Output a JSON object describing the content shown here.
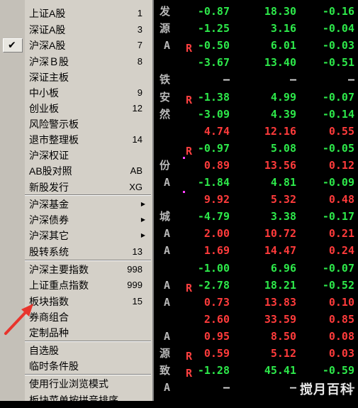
{
  "menu": {
    "items": [
      {
        "label": "上证A股",
        "shortcut": "1"
      },
      {
        "label": "深证A股",
        "shortcut": "3"
      },
      {
        "label": "沪深A股",
        "shortcut": "7",
        "checked": true
      },
      {
        "label": "沪深Ｂ股",
        "shortcut": "8"
      },
      {
        "label": "深证主板",
        "shortcut": ""
      },
      {
        "label": "中小板",
        "shortcut": "9"
      },
      {
        "label": "创业板",
        "shortcut": "12"
      },
      {
        "label": "风险警示板",
        "shortcut": ""
      },
      {
        "label": "退市整理板",
        "shortcut": "14"
      },
      {
        "label": "沪深权证",
        "shortcut": ""
      },
      {
        "label": "AB股对照",
        "shortcut": "AB"
      },
      {
        "label": "新股发行",
        "shortcut": "XG"
      },
      {
        "label": "沪深基金",
        "submenu": true
      },
      {
        "label": "沪深债券",
        "submenu": true
      },
      {
        "label": "沪深其它",
        "submenu": true
      },
      {
        "label": "股转系统",
        "shortcut": "13"
      },
      {
        "label": "沪深主要指数",
        "shortcut": "998"
      },
      {
        "label": "上证重点指数",
        "shortcut": "999"
      },
      {
        "label": "板块指数",
        "shortcut": "15"
      },
      {
        "label": "券商组合",
        "shortcut": ""
      },
      {
        "label": "定制品种",
        "shortcut": ""
      },
      {
        "label": "自选股",
        "shortcut": ""
      },
      {
        "label": "临时条件股",
        "shortcut": ""
      },
      {
        "label": "使用行业浏览模式",
        "shortcut": ""
      },
      {
        "label": "板块菜单按拼音排序",
        "shortcut": ""
      }
    ]
  },
  "quotes": [
    {
      "stub": "发",
      "mark": "",
      "chg": "-0.87",
      "price": "18.30",
      "pct": "-0.16",
      "dir": "down"
    },
    {
      "stub": "源",
      "mark": "",
      "chg": "-1.25",
      "price": "3.16",
      "pct": "-0.04",
      "dir": "down"
    },
    {
      "stub": "A",
      "mark": "R",
      "chg": "-0.50",
      "price": "6.01",
      "pct": "-0.03",
      "dir": "down"
    },
    {
      "stub": "",
      "mark": "",
      "chg": "-3.67",
      "price": "13.40",
      "pct": "-0.51",
      "dir": "down"
    },
    {
      "stub": "铁",
      "mark": "",
      "chg": "—",
      "price": "—",
      "pct": "—",
      "dir": "flat"
    },
    {
      "stub": "安",
      "mark": "R",
      "chg": "-1.38",
      "price": "4.99",
      "pct": "-0.07",
      "dir": "down"
    },
    {
      "stub": "然",
      "mark": "",
      "chg": "-3.09",
      "price": "4.39",
      "pct": "-0.14",
      "dir": "down"
    },
    {
      "stub": "",
      "mark": "",
      "chg": "4.74",
      "price": "12.16",
      "pct": "0.55",
      "dir": "up"
    },
    {
      "stub": "",
      "mark": "R",
      "chg": "-0.97",
      "price": "5.08",
      "pct": "-0.05",
      "dir": "down"
    },
    {
      "stub": "份",
      "mark": "dot",
      "chg": "0.89",
      "price": "13.56",
      "pct": "0.12",
      "dir": "up"
    },
    {
      "stub": "A",
      "mark": "",
      "chg": "-1.84",
      "price": "4.81",
      "pct": "-0.09",
      "dir": "down"
    },
    {
      "stub": "",
      "mark": "dot",
      "chg": "9.92",
      "price": "5.32",
      "pct": "0.48",
      "dir": "up"
    },
    {
      "stub": "城",
      "mark": "",
      "chg": "-4.79",
      "price": "3.38",
      "pct": "-0.17",
      "dir": "down"
    },
    {
      "stub": "A",
      "mark": "",
      "chg": "2.00",
      "price": "10.72",
      "pct": "0.21",
      "dir": "up"
    },
    {
      "stub": "A",
      "mark": "",
      "chg": "1.69",
      "price": "14.47",
      "pct": "0.24",
      "dir": "up"
    },
    {
      "stub": "",
      "mark": "",
      "chg": "-1.00",
      "price": "6.96",
      "pct": "-0.07",
      "dir": "down"
    },
    {
      "stub": "A",
      "mark": "R",
      "chg": "-2.78",
      "price": "18.21",
      "pct": "-0.52",
      "dir": "down"
    },
    {
      "stub": "A",
      "mark": "",
      "chg": "0.73",
      "price": "13.83",
      "pct": "0.10",
      "dir": "up"
    },
    {
      "stub": "",
      "mark": "",
      "chg": "2.60",
      "price": "33.59",
      "pct": "0.85",
      "dir": "up"
    },
    {
      "stub": "A",
      "mark": "",
      "chg": "0.95",
      "price": "8.50",
      "pct": "0.08",
      "dir": "up"
    },
    {
      "stub": "源",
      "mark": "R",
      "chg": "0.59",
      "price": "5.12",
      "pct": "0.03",
      "dir": "up"
    },
    {
      "stub": "致",
      "mark": "R",
      "chg": "-1.28",
      "price": "45.41",
      "pct": "-0.59",
      "dir": "down"
    },
    {
      "stub": "A",
      "mark": "",
      "chg": "—",
      "price": "—",
      "pct": "—",
      "dir": "flat"
    }
  ],
  "colors": {
    "up": "#ff3b3b",
    "down": "#2de84a",
    "annotation": "#e8342c"
  },
  "watermark": "搅月百科"
}
